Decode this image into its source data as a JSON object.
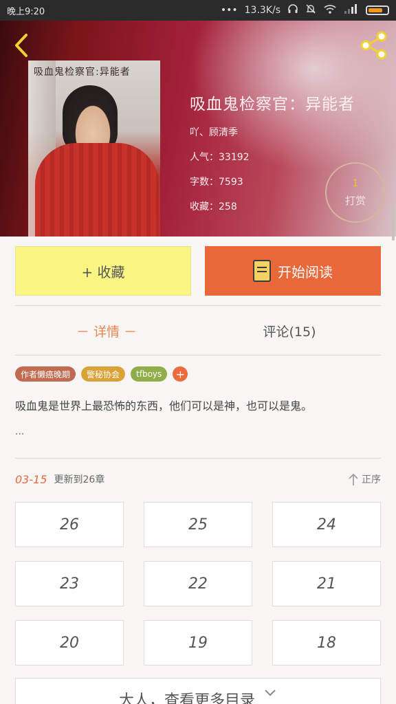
{
  "status_bar": {
    "time": "晚上9:20",
    "speed": "13.3K/s",
    "icons": [
      "dots-icon",
      "headphones-icon",
      "bell-off-icon",
      "wifi-icon",
      "signal-icon",
      "battery-icon"
    ]
  },
  "hero": {
    "cover_title": "吸血鬼检察官:异能者",
    "book_title": "吸血鬼检察官：异能者",
    "author": "吖、顾清季",
    "popularity": "人气：33192",
    "word_count": "字数：7593",
    "favorites": "收藏：258",
    "tip_count": "1",
    "tip_label": "打赏"
  },
  "actions": {
    "favorite_label": "+ 收藏",
    "read_label": "开始阅读"
  },
  "tabs": {
    "details": "－ 详情 －",
    "comments": "评论(15)"
  },
  "tags": [
    {
      "label": "作者懒癌晚期",
      "color": "#c06a50"
    },
    {
      "label": "警秘协会",
      "color": "#d9a338"
    },
    {
      "label": "tfboys",
      "color": "#8fae4a"
    }
  ],
  "tag_add": "+",
  "description": "吸血鬼是世界上最恐怖的东西，他们可以是神，也可以是鬼。",
  "description_more": "···",
  "update": {
    "date": "03-15",
    "text": "更新到26章",
    "sort_label": "正序"
  },
  "chapters": [
    "26",
    "25",
    "24",
    "23",
    "22",
    "21",
    "20",
    "19",
    "18"
  ],
  "more_label": "大人，查看更多目录",
  "colors": {
    "accent": "#ec6a3b",
    "favorite_bg": "#fbf684",
    "read_bg": "#e9683a"
  }
}
